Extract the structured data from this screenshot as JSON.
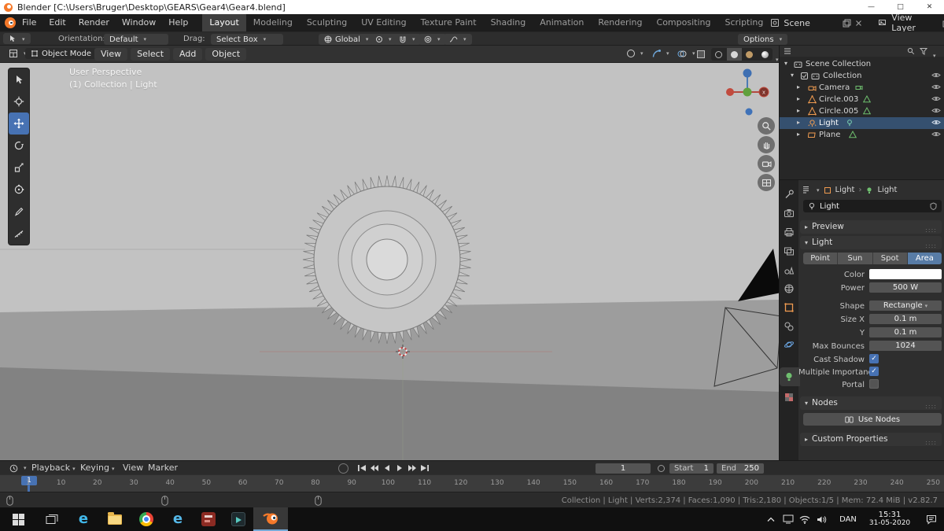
{
  "window": {
    "title": "Blender [C:\\Users\\Bruger\\Desktop\\GEARS\\Gear4\\Gear4.blend]",
    "controls": {
      "minimize": "—",
      "maximize": "□",
      "close": "✕"
    }
  },
  "menubar": {
    "menus": [
      "File",
      "Edit",
      "Render",
      "Window",
      "Help"
    ],
    "workspaces": [
      "Layout",
      "Modeling",
      "Sculpting",
      "UV Editing",
      "Texture Paint",
      "Shading",
      "Animation",
      "Rendering",
      "Compositing",
      "Scripting"
    ],
    "active_workspace": "Layout",
    "scene_label": "Scene",
    "view_layer_label": "View Layer"
  },
  "toolbar": {
    "orientation_label": "Orientation:",
    "orientation_value": "Default",
    "drag_label": "Drag:",
    "drag_value": "Select Box",
    "pivot_value": "Global",
    "options_label": "Options"
  },
  "viewport": {
    "mode": "Object Mode",
    "menus": [
      "View",
      "Select",
      "Add",
      "Object"
    ],
    "overlay_line1": "User Perspective",
    "overlay_line2": "(1) Collection | Light"
  },
  "outliner": {
    "rows": [
      {
        "label": "Scene Collection"
      },
      {
        "label": "Collection"
      },
      {
        "label": "Camera"
      },
      {
        "label": "Circle.003"
      },
      {
        "label": "Circle.005"
      },
      {
        "label": "Light"
      },
      {
        "label": "Plane"
      }
    ]
  },
  "properties": {
    "breadcrumb_object": "Light",
    "breadcrumb_data": "Light",
    "name_value": "Light",
    "panels": {
      "preview": "Preview",
      "light": "Light",
      "nodes": "Nodes",
      "custom_properties": "Custom Properties"
    },
    "light_types": [
      "Point",
      "Sun",
      "Spot",
      "Area"
    ],
    "active_type": "Area",
    "rows": {
      "color_label": "Color",
      "power_label": "Power",
      "power_value": "500 W",
      "shape_label": "Shape",
      "shape_value": "Rectangle",
      "size_x_label": "Size X",
      "size_x_value": "0.1 m",
      "size_y_label": "Y",
      "size_y_value": "0.1 m",
      "max_bounces_label": "Max Bounces",
      "max_bounces_value": "1024",
      "cast_shadow_label": "Cast Shadow",
      "multiple_importance_label": "Multiple Importance",
      "portal_label": "Portal"
    },
    "use_nodes_label": "Use Nodes"
  },
  "timeline": {
    "menus": [
      "Playback",
      "Keying",
      "View",
      "Marker"
    ],
    "current_frame": "1",
    "start_label": "Start",
    "start_value": "1",
    "end_label": "End",
    "end_value": "250",
    "ticks": [
      "1",
      "10",
      "20",
      "30",
      "40",
      "50",
      "60",
      "70",
      "80",
      "90",
      "100",
      "110",
      "120",
      "130",
      "140",
      "150",
      "160",
      "170",
      "180",
      "190",
      "200",
      "210",
      "220",
      "230",
      "240",
      "250"
    ]
  },
  "statusbar": {
    "stats": "Collection | Light | Verts:2,374 | Faces:1,090 | Tris:2,180 | Objects:1/5 | Mem: 72.4 MiB | v2.82.7"
  },
  "taskbar": {
    "language": "DAN",
    "time": "15:31",
    "date": "31-05-2020"
  },
  "colors": {
    "accent": "#4772b3",
    "selection": "#35506f",
    "object_orange": "#ef9b50",
    "data_green": "#6fbf6f",
    "blender_orange": "#f5792a"
  }
}
